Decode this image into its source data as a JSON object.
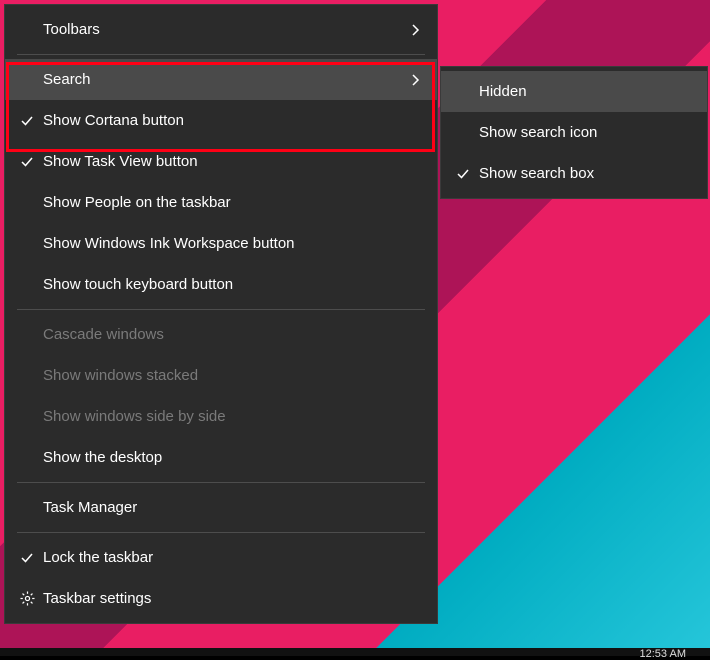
{
  "menu": {
    "toolbars": "Toolbars",
    "search": "Search",
    "show_cortana": "Show Cortana button",
    "show_task_view": "Show Task View button",
    "show_people": "Show People on the taskbar",
    "show_ink": "Show Windows Ink Workspace button",
    "show_touch_kb": "Show touch keyboard button",
    "cascade": "Cascade windows",
    "stacked": "Show windows stacked",
    "side_by_side": "Show windows side by side",
    "show_desktop": "Show the desktop",
    "task_manager": "Task Manager",
    "lock_taskbar": "Lock the taskbar",
    "taskbar_settings": "Taskbar settings"
  },
  "submenu": {
    "hidden": "Hidden",
    "show_icon": "Show search icon",
    "show_box": "Show search box"
  },
  "clock": "12:53 AM"
}
